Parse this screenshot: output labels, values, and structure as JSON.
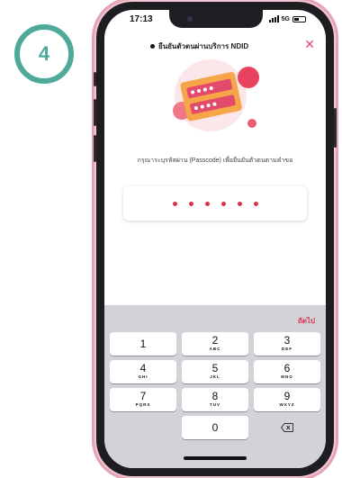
{
  "step": {
    "number": "4"
  },
  "status": {
    "time": "17:13",
    "network": "5G"
  },
  "header": {
    "title": "ยืนยันตัวตนผ่านบริการ NDID",
    "close_icon": "close-icon",
    "close_glyph": "✕"
  },
  "instruction": "กรุณาระบุรหัสผ่าน (Passcode) เพื่อยืนยันตัวตนตามคำขอ",
  "pin": {
    "length": 6,
    "dot_color": "#d8334f"
  },
  "keypad": {
    "next_label": "ถัดไป",
    "keys": [
      {
        "num": "1",
        "letters": ""
      },
      {
        "num": "2",
        "letters": "ABC"
      },
      {
        "num": "3",
        "letters": "DEF"
      },
      {
        "num": "4",
        "letters": "GHI"
      },
      {
        "num": "5",
        "letters": "JKL"
      },
      {
        "num": "6",
        "letters": "MNO"
      },
      {
        "num": "7",
        "letters": "PQRS"
      },
      {
        "num": "8",
        "letters": "TUV"
      },
      {
        "num": "9",
        "letters": "WXYZ"
      },
      {
        "num": "0",
        "letters": ""
      }
    ],
    "delete_icon": "backspace-icon"
  },
  "colors": {
    "accent": "#d8334f",
    "badge": "#4fa99a",
    "phone_outline": "#e7a3b6"
  }
}
